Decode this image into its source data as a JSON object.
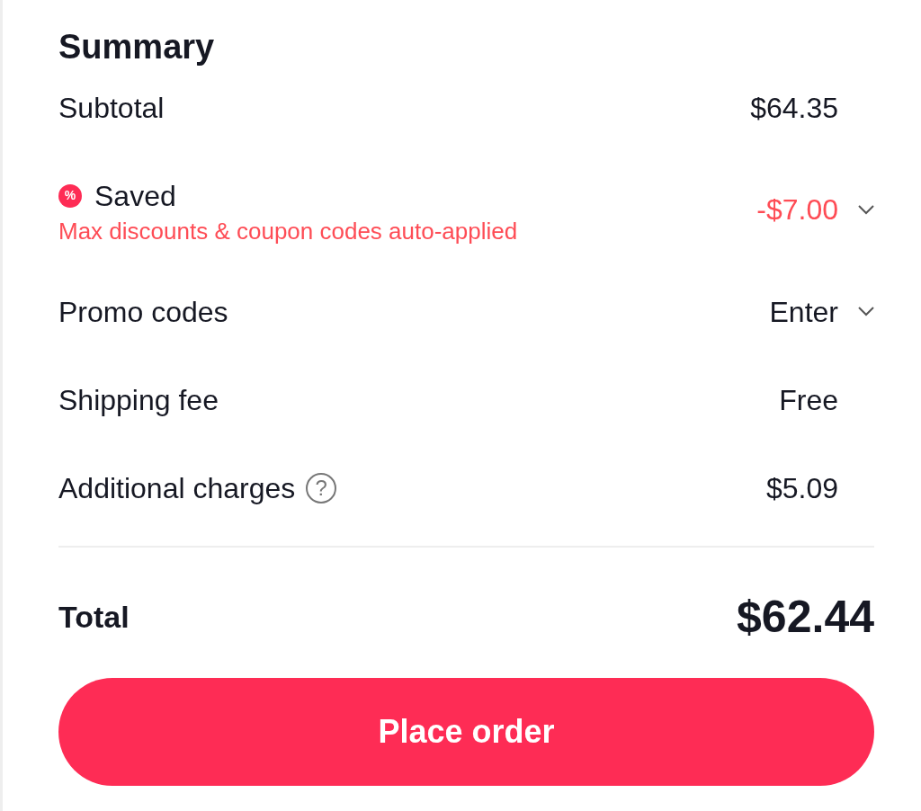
{
  "title": "Summary",
  "rows": [
    {
      "kind": "plain",
      "label": "Subtotal",
      "value": "$64.35",
      "expandable": false
    },
    {
      "kind": "discount",
      "label": "Saved",
      "badge": "%",
      "note": "Max discounts & coupon codes auto-applied",
      "value": "-$7.00",
      "expandable": true
    },
    {
      "kind": "plain",
      "label": "Promo codes",
      "value": "Enter",
      "expandable": true
    },
    {
      "kind": "plain",
      "label": "Shipping fee",
      "value": "Free",
      "expandable": false
    },
    {
      "kind": "help",
      "label": "Additional charges",
      "help": "?",
      "value": "$5.09",
      "expandable": false
    }
  ],
  "total": {
    "label": "Total",
    "value": "$62.44"
  },
  "button": "Place order"
}
